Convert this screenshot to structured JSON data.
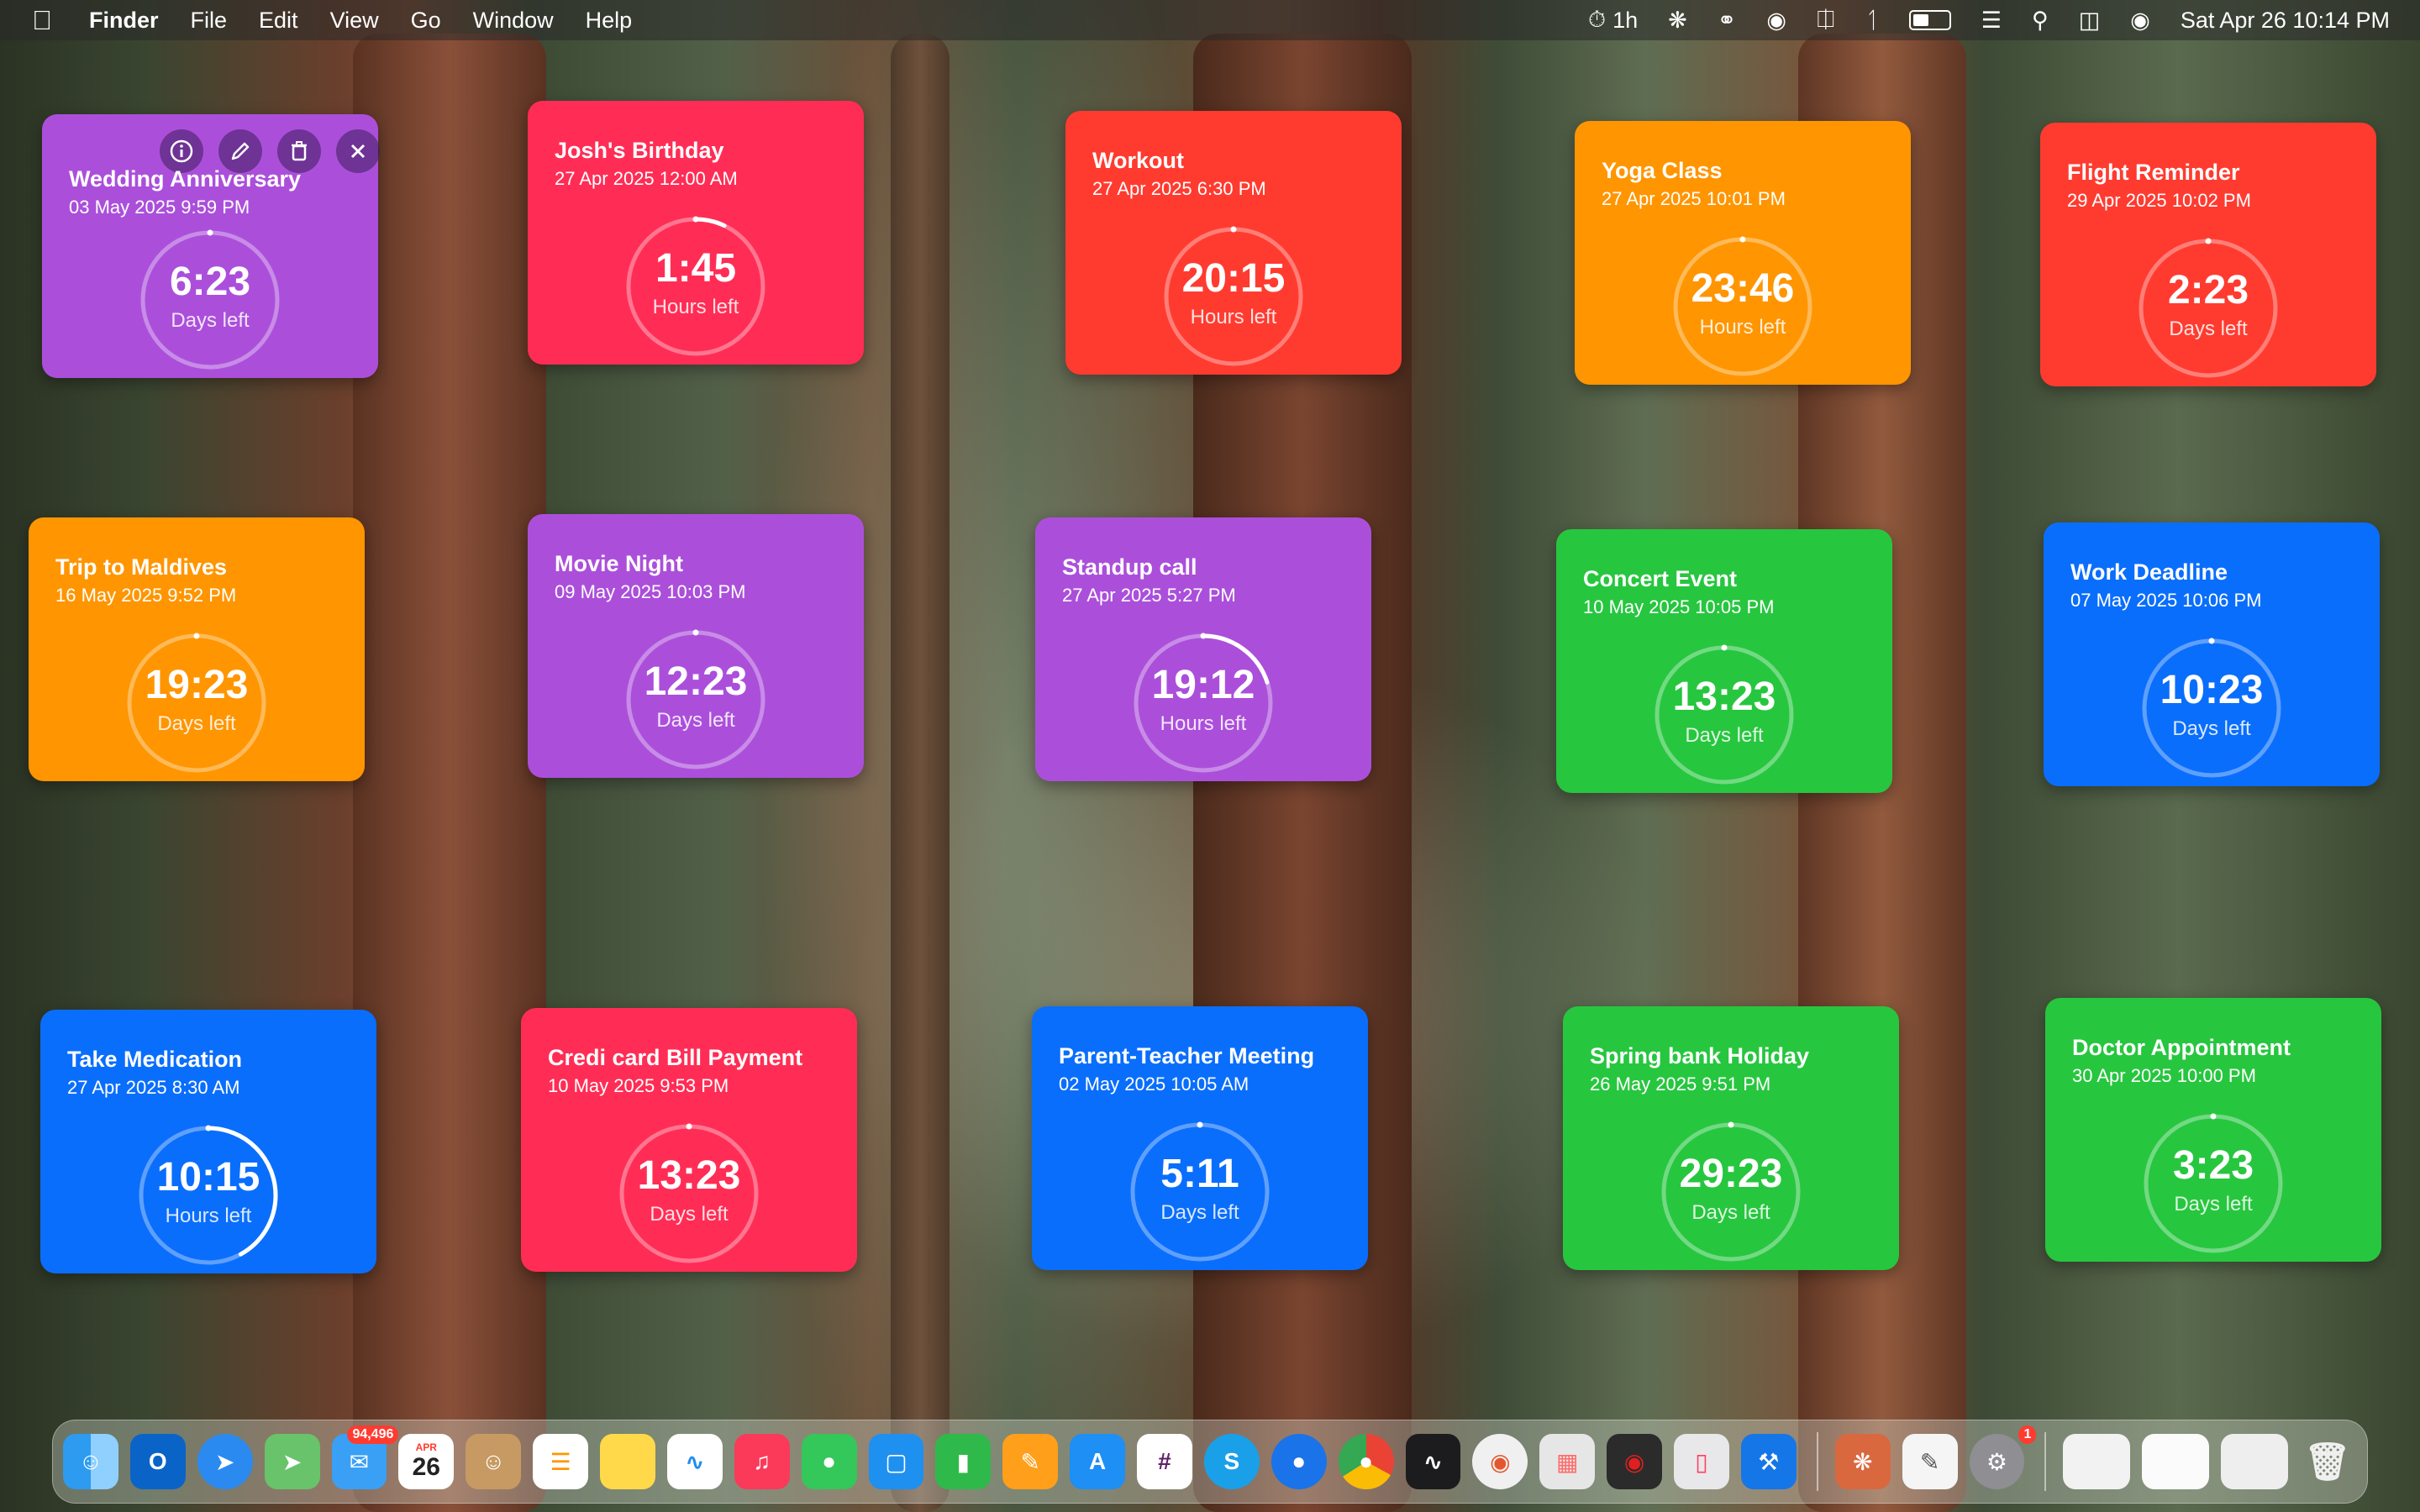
{
  "menubar": {
    "app": "Finder",
    "menus": [
      "File",
      "Edit",
      "View",
      "Go",
      "Window",
      "Help"
    ],
    "timer": "1h",
    "datetime": "Sat Apr 26  10:14 PM"
  },
  "widgets": [
    {
      "title": "Wedding Anniversary",
      "date": "03 May 2025 9:59 PM",
      "value": "6:23",
      "unit": "Days left",
      "progress": 1.0,
      "color": "#ab4fdb"
    },
    {
      "title": "Josh's Birthday",
      "date": "27 Apr 2025 12:00 AM",
      "value": "1:45",
      "unit": "Hours left",
      "progress": 0.07,
      "color": "#ff2d55"
    },
    {
      "title": "Workout",
      "date": "27 Apr 2025 6:30 PM",
      "value": "20:15",
      "unit": "Hours left",
      "progress": 1.0,
      "color": "#ff3b30"
    },
    {
      "title": "Yoga Class",
      "date": "27 Apr 2025 10:01 PM",
      "value": "23:46",
      "unit": "Hours left",
      "progress": 1.0,
      "color": "#ff9500"
    },
    {
      "title": "Flight Reminder",
      "date": "29 Apr 2025 10:02 PM",
      "value": "2:23",
      "unit": "Days left",
      "progress": 1.0,
      "color": "#ff3b30"
    },
    {
      "title": "Trip to Maldives",
      "date": "16 May 2025 9:52 PM",
      "value": "19:23",
      "unit": "Days left",
      "progress": 1.0,
      "color": "#ff9500"
    },
    {
      "title": "Movie Night",
      "date": "09 May 2025 10:03 PM",
      "value": "12:23",
      "unit": "Days left",
      "progress": 1.0,
      "color": "#ab4fdb"
    },
    {
      "title": "Standup call",
      "date": "27 Apr 2025 5:27 PM",
      "value": "19:12",
      "unit": "Hours left",
      "progress": 0.2,
      "color": "#ab4fdb"
    },
    {
      "title": "Concert Event",
      "date": "10 May 2025 10:05 PM",
      "value": "13:23",
      "unit": "Days left",
      "progress": 1.0,
      "color": "#27c63f"
    },
    {
      "title": "Work Deadline",
      "date": "07 May 2025 10:06 PM",
      "value": "10:23",
      "unit": "Days left",
      "progress": 1.0,
      "color": "#0a6efc"
    },
    {
      "title": "Take Medication",
      "date": "27 Apr 2025 8:30 AM",
      "value": "10:15",
      "unit": "Hours left",
      "progress": 0.42,
      "color": "#0a6efc"
    },
    {
      "title": "Credi card Bill Payment",
      "date": "10 May 2025 9:53 PM",
      "value": "13:23",
      "unit": "Days left",
      "progress": 1.0,
      "color": "#ff2d55"
    },
    {
      "title": "Parent-Teacher Meeting",
      "date": "02 May 2025 10:05 AM",
      "value": "5:11",
      "unit": "Days left",
      "progress": 1.0,
      "color": "#0a6efc"
    },
    {
      "title": "Spring bank Holiday",
      "date": "26 May 2025 9:51 PM",
      "value": "29:23",
      "unit": "Days left",
      "progress": 1.0,
      "color": "#27c63f"
    },
    {
      "title": "Doctor Appointment",
      "date": "30 Apr 2025 10:00 PM",
      "value": "3:23",
      "unit": "Days left",
      "progress": 1.0,
      "color": "#27c63f"
    }
  ],
  "dock": {
    "apps": [
      "finder",
      "outlook",
      "safari",
      "maps",
      "mail",
      "calendar",
      "contacts",
      "reminders",
      "notes",
      "freeform",
      "music",
      "messages",
      "keynote",
      "numbers",
      "pages",
      "app-store",
      "slack",
      "skype",
      "pin",
      "chrome",
      "activity",
      "vpn",
      "launchpad",
      "screen-recorder",
      "iphone-mirroring",
      "xcode",
      "claude",
      "textedit",
      "system-settings",
      "downloads",
      "folder",
      "window",
      "trash"
    ],
    "mail_badge": "94,496",
    "calendar_month": "APR",
    "calendar_day": "26",
    "settings_badge": "1"
  }
}
